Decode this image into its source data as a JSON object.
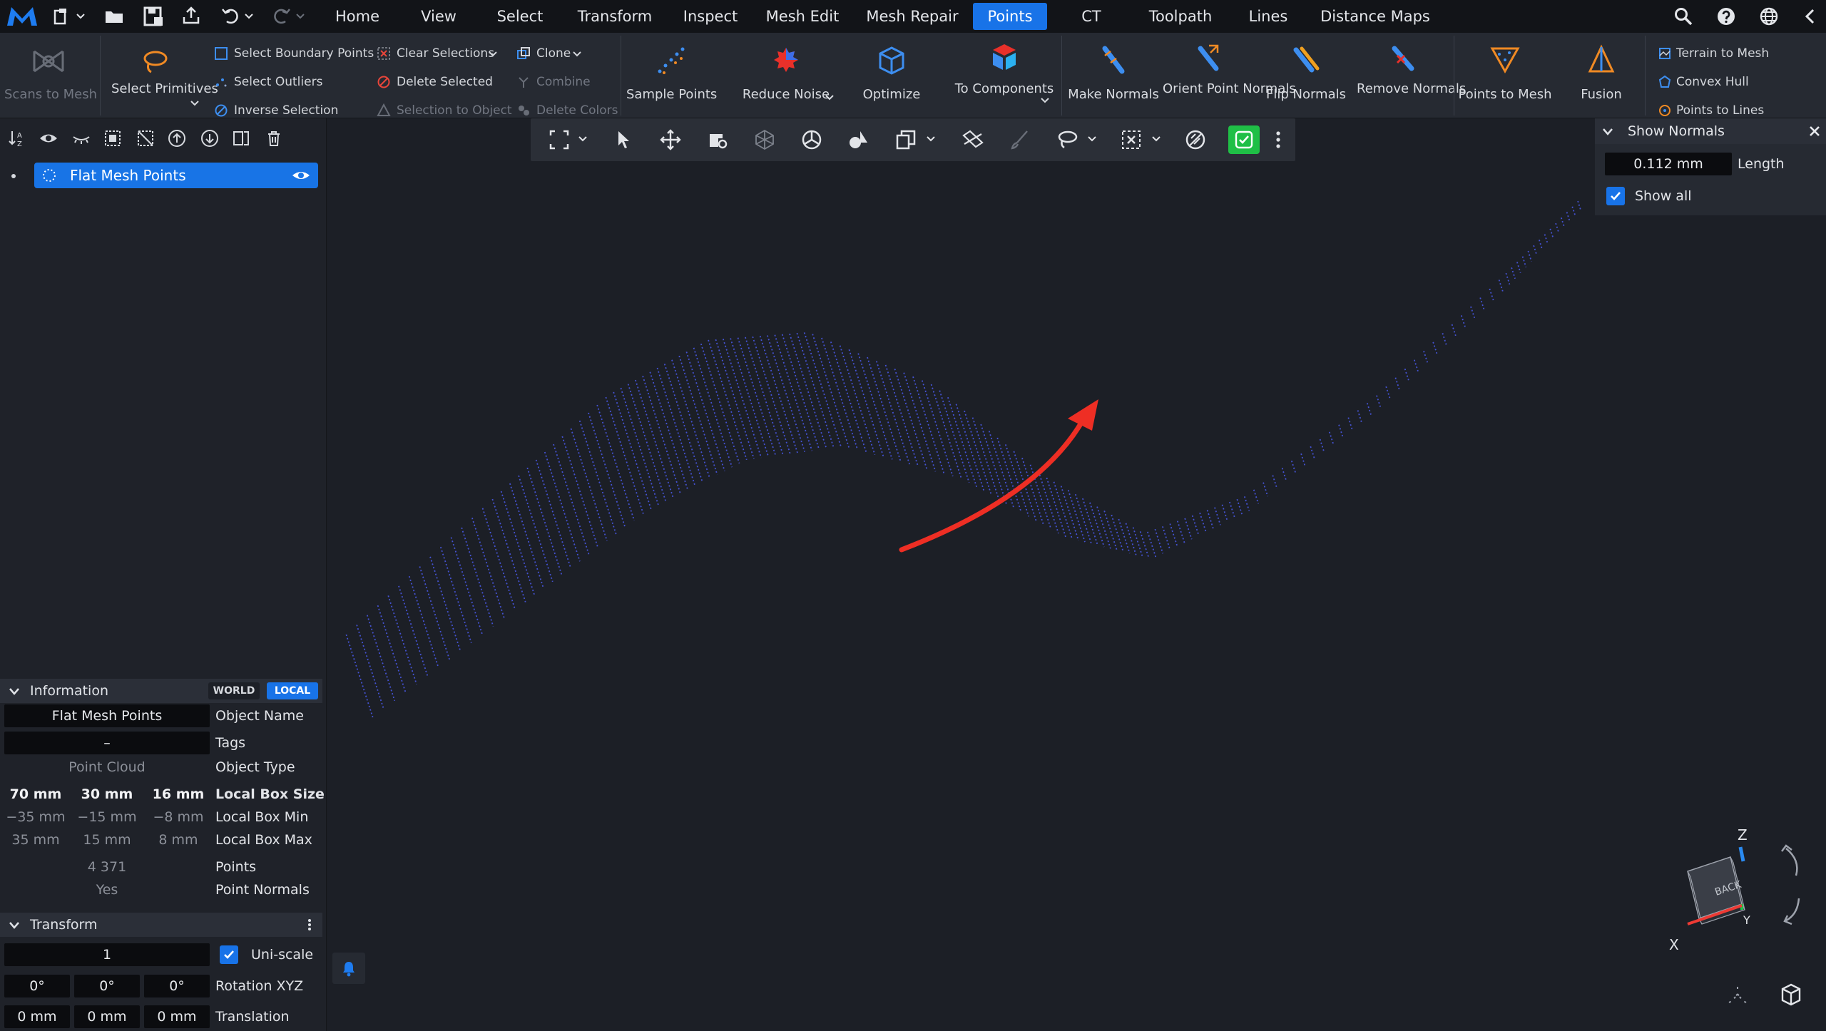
{
  "menu": {
    "tabs": [
      "Home",
      "View",
      "Select",
      "Transform",
      "Inspect",
      "Mesh Edit",
      "Mesh Repair",
      "Points",
      "CT",
      "Toolpath",
      "Lines",
      "Distance Maps"
    ],
    "active_tab": "Points"
  },
  "ribbon": {
    "scans_to_mesh": "Scans to Mesh",
    "select_primitives": "Select Primitives",
    "select_boundary_points": "Select Boundary Points",
    "select_outliers": "Select Outliers",
    "inverse_selection": "Inverse Selection",
    "clear_selections": "Clear Selections",
    "delete_selected": "Delete Selected",
    "selection_to_object": "Selection to Object",
    "clone": "Clone",
    "combine": "Combine",
    "delete_colors": "Delete Colors",
    "sample_points": "Sample Points",
    "reduce_noise": "Reduce Noise",
    "optimize": "Optimize",
    "to_components": "To Components",
    "make_normals": "Make Normals",
    "orient_point_normals": "Orient Point Normals",
    "flip_normals": "Flip Normals",
    "remove_normals": "Remove Normals",
    "points_to_mesh": "Points to Mesh",
    "fusion": "Fusion",
    "terrain_to_mesh": "Terrain to Mesh",
    "convex_hull": "Convex Hull",
    "points_to_lines": "Points to Lines"
  },
  "scene": {
    "object_name": "Flat Mesh Points"
  },
  "info": {
    "title": "Information",
    "world": "WORLD",
    "local": "LOCAL",
    "object_name_value": "Flat Mesh Points",
    "object_name_label": "Object Name",
    "tags_value": "–",
    "tags_label": "Tags",
    "object_type_value": "Point Cloud",
    "object_type_label": "Object Type",
    "box_size": [
      "70 mm",
      "30 mm",
      "16 mm"
    ],
    "box_size_label": "Local Box Size",
    "box_min": [
      "−35 mm",
      "−15 mm",
      "−8 mm"
    ],
    "box_min_label": "Local Box Min",
    "box_max": [
      "35 mm",
      "15 mm",
      "8 mm"
    ],
    "box_max_label": "Local Box Max",
    "points_value": "4 371",
    "points_label": "Points",
    "normals_value": "Yes",
    "normals_label": "Point Normals"
  },
  "transform": {
    "title": "Transform",
    "scale_value": "1",
    "uniscale_label": "Uni-scale",
    "uniscale_checked": true,
    "rotation": [
      "0°",
      "0°",
      "0°"
    ],
    "rotation_label": "Rotation XYZ",
    "translation": [
      "0 mm",
      "0 mm",
      "0 mm"
    ],
    "translation_label": "Translation"
  },
  "normals_panel": {
    "title": "Show Normals",
    "length_value": "0.112 mm",
    "length_label": "Length",
    "show_all_label": "Show all",
    "show_all_checked": true
  },
  "view_cube": {
    "face_label": "BACK",
    "axis_z": "Z",
    "axis_x": "X",
    "axis_y": "Y"
  },
  "colors": {
    "accent": "#1873e8",
    "points": "#4b5cf0",
    "arrow": "#ee2e24",
    "active_tool": "#1fbf46"
  }
}
